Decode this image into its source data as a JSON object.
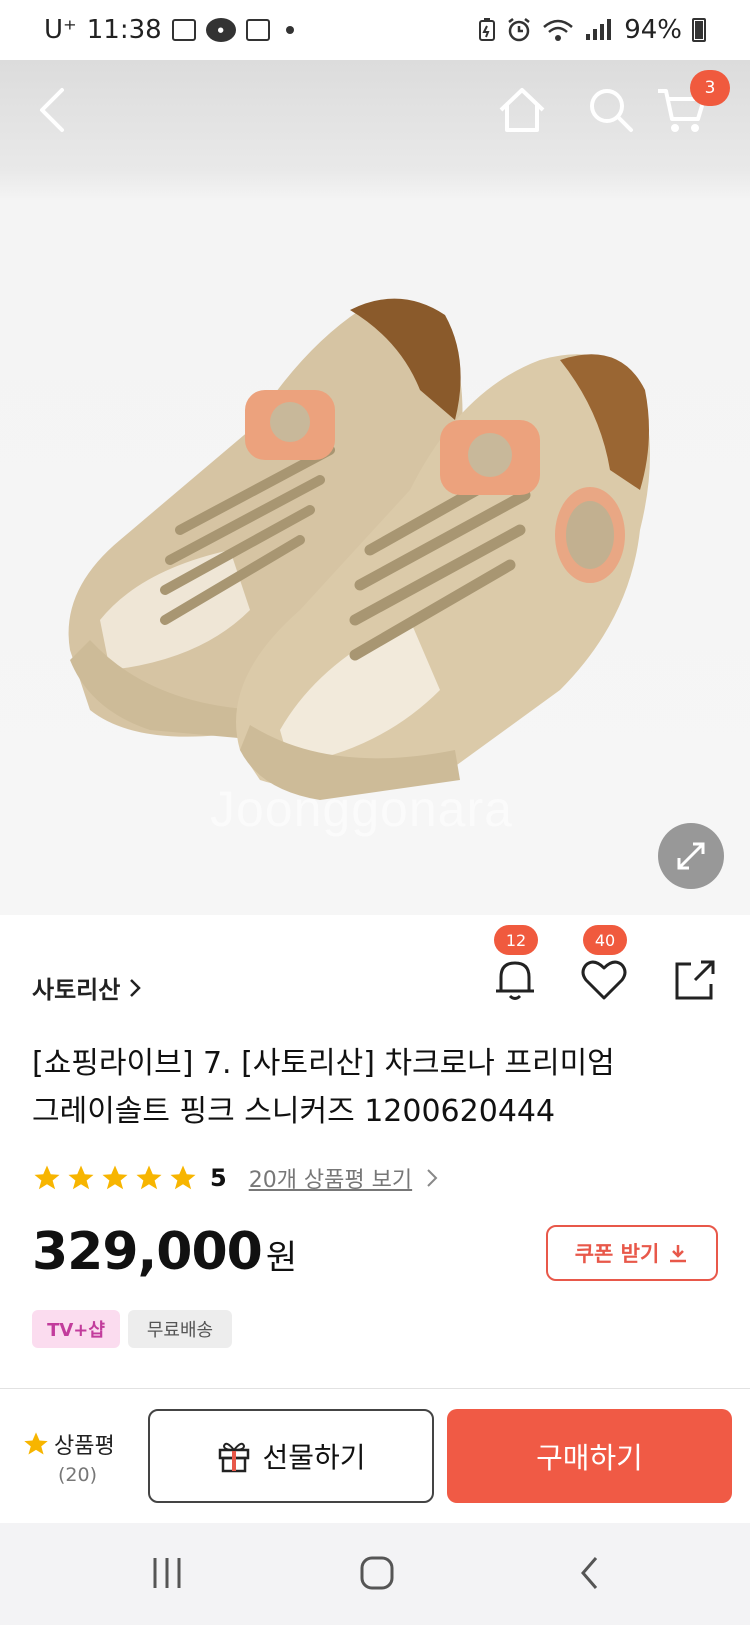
{
  "status_bar": {
    "carrier": "U⁺",
    "time": "11:38",
    "battery": "94%",
    "icons": [
      "gallery-icon",
      "kakaotalk-icon",
      "calendar-icon",
      "battery-saver-icon",
      "alarm-icon",
      "wifi-icon",
      "signal-icon",
      "battery-icon"
    ]
  },
  "header": {
    "cart_count": "3",
    "icons": [
      "back-icon",
      "home-icon",
      "search-icon",
      "cart-icon"
    ]
  },
  "product_image": {
    "watermark": "Joonggonara",
    "expand_icon": "expand-icon"
  },
  "product": {
    "brand": "사토리산",
    "alarm_count": "12",
    "like_count": "40",
    "title_line1": "[쇼핑라이브] 7. [사토리산] 차크로나 프리미엄",
    "title_line2": "그레이솔트 핑크 스니커즈 1200620444",
    "rating": 5,
    "rating_text": "5",
    "review_link": "20개 상품평 보기",
    "price": "329,000",
    "currency": "원",
    "coupon_label": "쿠폰 받기",
    "tags": {
      "tv": "TV+샵",
      "shipping": "무료배송"
    }
  },
  "bottom_bar": {
    "review_label": "상품평",
    "review_count": "(20)",
    "gift_label": "선물하기",
    "buy_label": "구매하기"
  },
  "colors": {
    "accent": "#f05a45",
    "badge": "#f05a3e",
    "star": "#f7b500",
    "tv_tag_bg": "#fbdcef",
    "tv_tag_text": "#c23c9c"
  }
}
